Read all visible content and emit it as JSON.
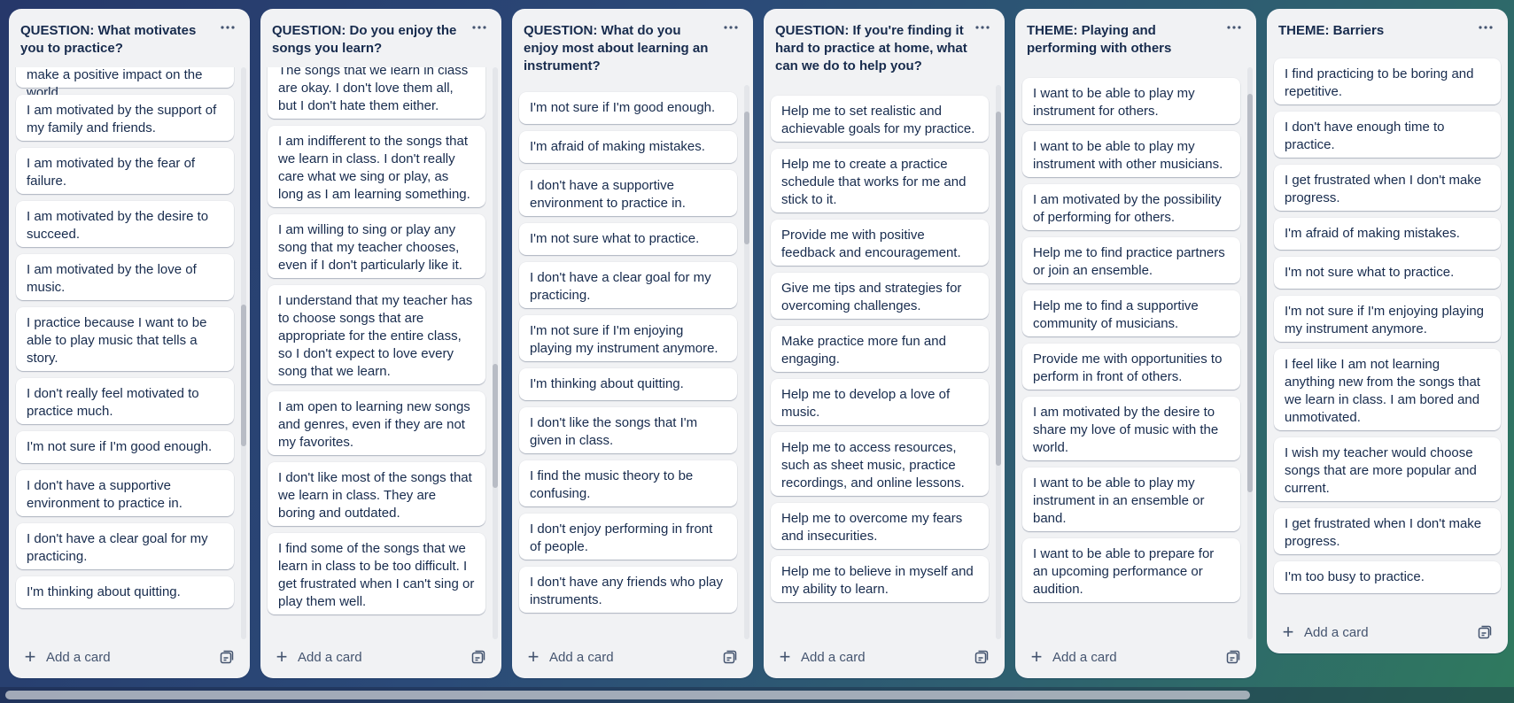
{
  "board": {
    "add_card_label": "Add a card",
    "lists": [
      {
        "title": "QUESTION: What motivates you to practice?",
        "cards": [
          "I am motivated by the desire to make a positive impact on the world.",
          "I am motivated by the support of my family and friends.",
          "I am motivated by the fear of failure.",
          "I am motivated by the desire to succeed.",
          "I am motivated by the love of music.",
          "I practice because I want to be able to play music that tells a story.",
          "I don't really feel motivated to practice much.",
          "I'm not sure if I'm good enough.",
          "I don't have a supportive environment to practice in.",
          "I don't have a clear goal for my practicing.",
          "I'm thinking about quitting."
        ]
      },
      {
        "title": "QUESTION: Do you enjoy the songs you learn?",
        "cards": [
          "The songs that we learn in class are okay. I don't love them all, but I don't hate them either.",
          "I am indifferent to the songs that we learn in class. I don't really care what we sing or play, as long as I am learning something.",
          "I am willing to sing or play any song that my teacher chooses, even if I don't particularly like it.",
          "I understand that my teacher has to choose songs that are appropriate for the entire class, so I don't expect to love every song that we learn.",
          "I am open to learning new songs and genres, even if they are not my favorites.",
          "I don't like most of the songs that we learn in class. They are boring and outdated.",
          "I find some of the songs that we learn in class to be too difficult. I get frustrated when I can't sing or play them well."
        ]
      },
      {
        "title": "QUESTION: What do you enjoy most about learning an instrument?",
        "cards": [
          "I'm not sure if I'm good enough.",
          "I'm afraid of making mistakes.",
          "I don't have a supportive environment to practice in.",
          "I'm not sure what to practice.",
          "I don't have a clear goal for my practicing.",
          "I'm not sure if I'm enjoying playing my instrument anymore.",
          "I'm thinking about quitting.",
          "I don't like the songs that I'm given in class.",
          "I find the music theory to be confusing.",
          "I don't enjoy performing in front of people.",
          "I don't have any friends who play instruments."
        ]
      },
      {
        "title": "QUESTION: If you're finding it hard to practice at home, what can we do to help you?",
        "cards": [
          "Help me to set realistic and achievable goals for my practice.",
          "Help me to create a practice schedule that works for me and stick to it.",
          "Provide me with positive feedback and encouragement.",
          "Give me tips and strategies for overcoming challenges.",
          "Make practice more fun and engaging.",
          "Help me to develop a love of music.",
          "Help me to access resources, such as sheet music, practice recordings, and online lessons.",
          "Help me to overcome my fears and insecurities.",
          "Help me to believe in myself and my ability to learn."
        ]
      },
      {
        "title": "THEME: Playing and performing with others",
        "cards": [
          "I want to be able to play my instrument for others.",
          "I want to be able to play my instrument with other musicians.",
          "I am motivated by the possibility of performing for others.",
          "Help me to find practice partners or join an ensemble.",
          "Help me to find a supportive community of musicians.",
          "Provide me with opportunities to perform in front of others.",
          "I am motivated by the desire to share my love of music with the world.",
          "I want to be able to play my instrument in an ensemble or band.",
          "I want to be able to prepare for an upcoming performance or audition."
        ]
      },
      {
        "title": "THEME: Barriers",
        "cards": [
          "I find practicing to be boring and repetitive.",
          "I don't have enough time to practice.",
          "I get frustrated when I don't make progress.",
          "I'm afraid of making mistakes.",
          "I'm not sure what to practice.",
          "I'm not sure if I'm enjoying playing my instrument anymore.",
          "I feel like I am not learning anything new from the songs that we learn in class. I am bored and unmotivated.",
          "I wish my teacher would choose songs that are more popular and current.",
          "I get frustrated when I don't make progress.",
          "I'm too busy to practice."
        ]
      }
    ]
  }
}
